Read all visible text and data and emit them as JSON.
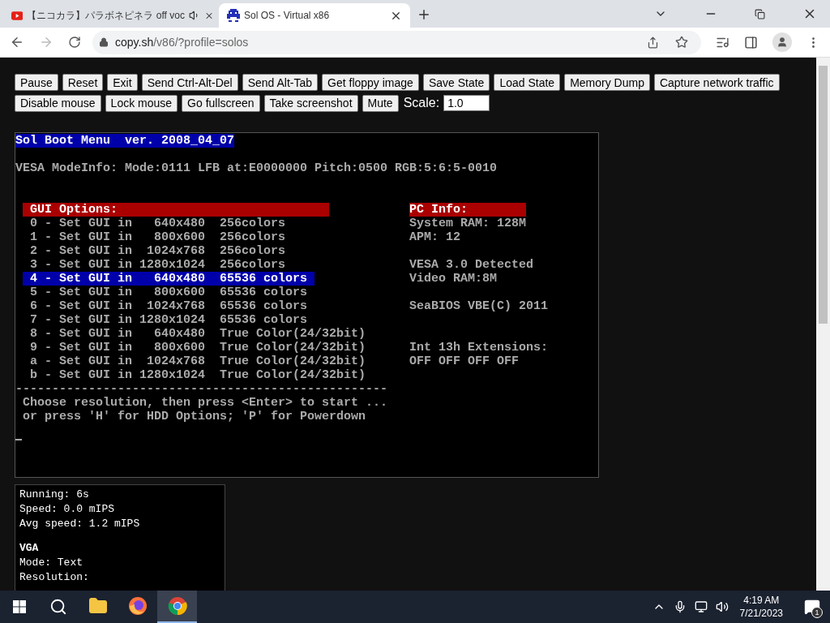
{
  "browser": {
    "tabs": [
      {
        "kind": "video",
        "title": "【ニコカラ】パラボネピネラ off voc",
        "playing_audio": true,
        "selected": false
      },
      {
        "kind": "invader",
        "title": "Sol OS - Virtual x86",
        "playing_audio": false,
        "selected": true
      }
    ],
    "url": {
      "host": "copy.sh",
      "path": "/v86/?profile=solos"
    }
  },
  "controls": {
    "rows": [
      {
        "buttons": [
          "Pause",
          "Reset",
          "Exit",
          "Send Ctrl-Alt-Del",
          "Send Alt-Tab",
          "Get floppy image",
          "Save State",
          "Load State",
          "Memory Dump",
          "Capture network traffic"
        ]
      },
      {
        "buttons": [
          "Disable mouse",
          "Lock mouse",
          "Go fullscreen",
          "Take screenshot",
          "Mute"
        ]
      }
    ],
    "scale": {
      "label": "Scale:",
      "value": "1.0"
    }
  },
  "terminal": {
    "title": "Sol Boot Menu  ver. 2008_04_07",
    "vesa_info": "VESA ModeInfo: Mode:0111 LFB at:E0000000 Pitch:0500 RGB:5:6:5-0010",
    "gui_options": {
      "heading": "GUI Options:",
      "items": [
        {
          "text": "0 - Set GUI in   640x480  256colors",
          "selected": false
        },
        {
          "text": "1 - Set GUI in   800x600  256colors",
          "selected": false
        },
        {
          "text": "2 - Set GUI in  1024x768  256colors",
          "selected": false
        },
        {
          "text": "3 - Set GUI in 1280x1024  256colors",
          "selected": false
        },
        {
          "text": "4 - Set GUI in   640x480  65536 colors",
          "selected": true
        },
        {
          "text": "5 - Set GUI in   800x600  65536 colors",
          "selected": false
        },
        {
          "text": "6 - Set GUI in  1024x768  65536 colors",
          "selected": false
        },
        {
          "text": "7 - Set GUI in 1280x1024  65536 colors",
          "selected": false
        },
        {
          "text": "8 - Set GUI in   640x480  True Color(24/32bit)",
          "selected": false
        },
        {
          "text": "9 - Set GUI in   800x600  True Color(24/32bit)",
          "selected": false
        },
        {
          "text": "a - Set GUI in  1024x768  True Color(24/32bit)",
          "selected": false
        },
        {
          "text": "b - Set GUI in 1280x1024  True Color(24/32bit)",
          "selected": false
        }
      ]
    },
    "divider": "---------------------------------------------------",
    "prompt_lines": [
      "Choose resolution, then press <Enter> to start ...",
      "or press 'H' for HDD Options; 'P' for Powerdown"
    ],
    "pc_info": {
      "heading": "PC Info:",
      "groups": [
        [
          "System RAM: 128M",
          "APM: 12"
        ],
        [
          "VESA 3.0 Detected",
          "Video RAM:8M"
        ],
        [
          "SeaBIOS VBE(C) 2011"
        ]
      ],
      "extensions": {
        "heading": "Int 13h Extensions:",
        "value": "OFF OFF OFF OFF"
      }
    }
  },
  "stats": {
    "groups": [
      [
        {
          "kind": "text",
          "text": "Running: 6s"
        },
        {
          "kind": "text",
          "text": "Speed: 0.0 mIPS"
        },
        {
          "kind": "text",
          "text": "Avg speed: 1.2 mIPS"
        }
      ],
      [
        {
          "kind": "heading",
          "text": "VGA"
        },
        {
          "kind": "text",
          "text": "Mode: Text"
        },
        {
          "kind": "text",
          "text": "Resolution:"
        }
      ]
    ]
  },
  "taskbar": {
    "apps": [
      {
        "kind": "explorer",
        "selected": false
      },
      {
        "kind": "firefox",
        "selected": false
      },
      {
        "kind": "chrome",
        "selected": true
      }
    ],
    "clock": {
      "time": "4:19 AM",
      "date": "7/21/2023"
    },
    "notification_count": "1"
  }
}
